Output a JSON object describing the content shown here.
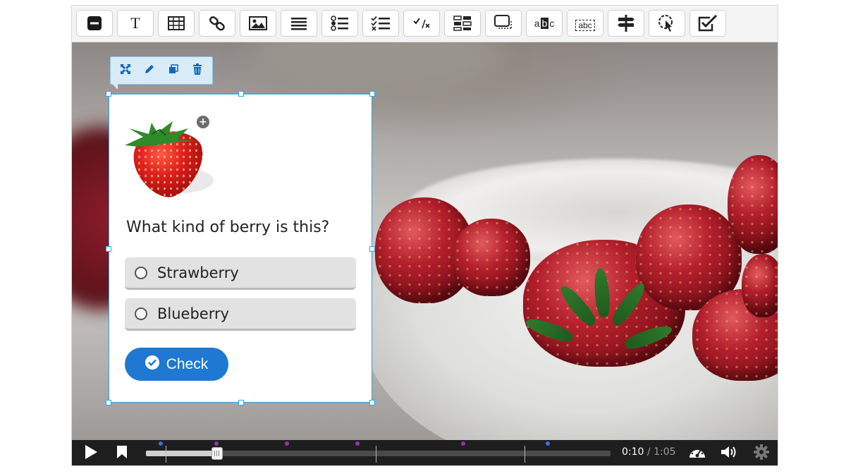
{
  "toolbar": {
    "buttons": [
      {
        "name": "statement-block-tool-button",
        "icon": "minus-block-icon"
      },
      {
        "name": "text-tool-button",
        "icon": "text-t-icon",
        "glyph": "T"
      },
      {
        "name": "table-tool-button",
        "icon": "table-icon"
      },
      {
        "name": "link-tool-button",
        "icon": "link-icon"
      },
      {
        "name": "image-tool-button",
        "icon": "image-icon"
      },
      {
        "name": "list-tool-button",
        "icon": "list-icon"
      },
      {
        "name": "bulleted-list-tool-button",
        "icon": "bulleted-list-icon"
      },
      {
        "name": "multiple-choice-tool-button",
        "icon": "checklist-icon"
      },
      {
        "name": "true-false-tool-button",
        "icon": "check-x-icon"
      },
      {
        "name": "drag-drop-tool-button",
        "icon": "drag-drop-icon"
      },
      {
        "name": "dialog-tool-button",
        "icon": "dialog-box-icon"
      },
      {
        "name": "mark-words-tool-button",
        "icon": "mark-words-icon",
        "glyph": "abc"
      },
      {
        "name": "fill-blanks-tool-button",
        "icon": "fill-blanks-icon",
        "glyph": "abc"
      },
      {
        "name": "crossroads-tool-button",
        "icon": "signpost-icon"
      },
      {
        "name": "navigation-hotspot-tool-button",
        "icon": "hotspot-pointer-icon"
      },
      {
        "name": "summary-tool-button",
        "icon": "checkbox-tick-icon"
      }
    ]
  },
  "card_toolbar": {
    "icons": [
      "expand-icon",
      "pencil-icon",
      "copy-icon",
      "trash-icon"
    ]
  },
  "question": {
    "text": "What kind of berry is this?",
    "answers": [
      "Strawberry",
      "Blueberry"
    ],
    "check_label": "Check",
    "image_badge": "+"
  },
  "player": {
    "current_time": "0:10",
    "separator": "/",
    "total_time": "1:05",
    "progress": 0.153,
    "markers": [
      0.042,
      0.495,
      0.815
    ],
    "interaction_dots": [
      {
        "pos": 0.032,
        "color": "#3d6ee8"
      },
      {
        "pos": 0.152,
        "color": "#9b2fb5"
      },
      {
        "pos": 0.304,
        "color": "#9b2fb5"
      },
      {
        "pos": 0.455,
        "color": "#9b2fb5"
      },
      {
        "pos": 0.683,
        "color": "#9b2fb5"
      },
      {
        "pos": 0.865,
        "color": "#3d6ee8"
      }
    ]
  },
  "colors": {
    "accent": "#2ea3e0",
    "check_button": "#1f78d1",
    "controls_bg": "#1e1e1e"
  }
}
